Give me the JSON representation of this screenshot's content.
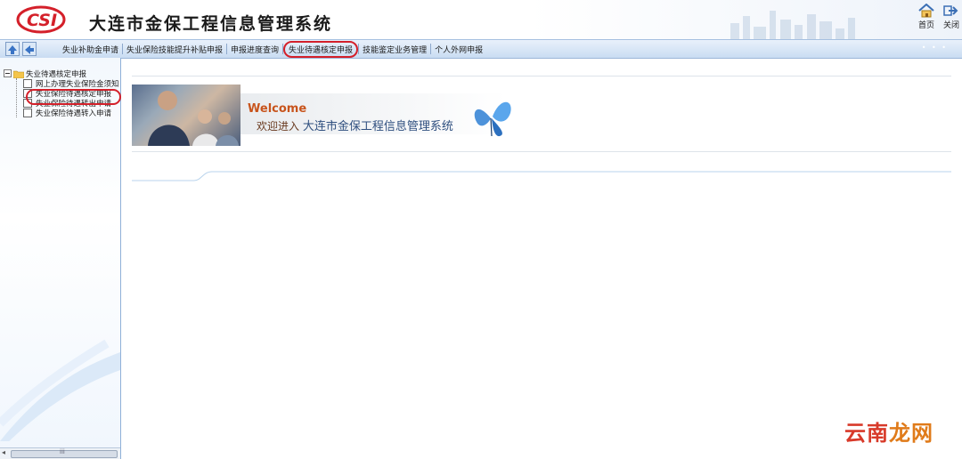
{
  "header": {
    "title": "大连市金保工程信息管理系统",
    "logo_text": "CSI",
    "home_label": "首页",
    "close_label": "关闭"
  },
  "toolbar": {
    "menu": [
      "失业补助金申请",
      "失业保险技能提升补贴申报",
      "申报进度查询",
      "失业待遇核定申报",
      "技能鉴定业务管理",
      "个人外网申报"
    ],
    "active_index": 3
  },
  "sidebar": {
    "root_label": "失业待遇核定申报",
    "items": [
      "网上办理失业保险金须知",
      "失业保险待遇核定申报",
      "失业保险待遇转出申请",
      "失业保险待遇转入申请"
    ],
    "selected_index": 1,
    "scroll_grip": "iii"
  },
  "main": {
    "welcome_en": "Welcome",
    "welcome_cn_prefix": "欢迎进入",
    "welcome_cn_title": "大连市金保工程信息管理系统"
  },
  "watermark": {
    "part1": "云南",
    "part2": "龙网"
  },
  "colors": {
    "accent_red": "#d4202a",
    "toolbar_blue": "#c9dcf2",
    "welcome_orange": "#c8541c"
  }
}
